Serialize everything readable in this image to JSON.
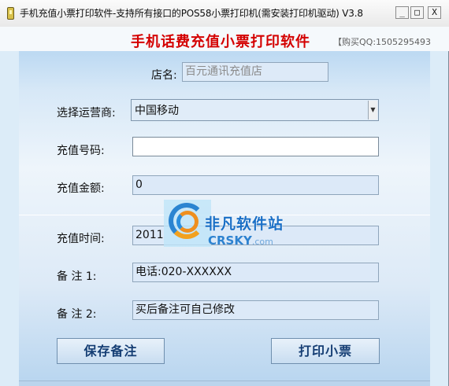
{
  "window": {
    "title": "手机充值小票打印软件-支持所有接口的POS58小票打印机(需安装打印机驱动)  V3.8",
    "minimize_glyph": "_",
    "maximize_glyph": "□",
    "close_glyph": "X"
  },
  "header": {
    "title": "手机话费充值小票打印软件",
    "qq_text": "【购买QQ:1505295493"
  },
  "form": {
    "shop_label": "店名:",
    "shop_value": "百元通讯充值店",
    "carrier_label": "选择运营商:",
    "carrier_value": "中国移动",
    "phone_label": "充值号码:",
    "phone_value": "",
    "amount_label": "充值金额:",
    "amount_value": "0",
    "time_label": "充值时间:",
    "time_value": "2011",
    "note1_label": "备   注 1:",
    "note1_value": "电话:020-XXXXXX",
    "note2_label": "备   注 2:",
    "note2_value": "买后备注可自己修改"
  },
  "buttons": {
    "save_label": "保存备注",
    "print_label": "打印小票"
  },
  "watermark": {
    "cn_text": "非凡软件站",
    "en_text": "CRSKY",
    "en_suffix": ".com"
  },
  "colors": {
    "header_title": "#d40000",
    "panel": "#dcecf8",
    "button_text": "#143d73"
  }
}
